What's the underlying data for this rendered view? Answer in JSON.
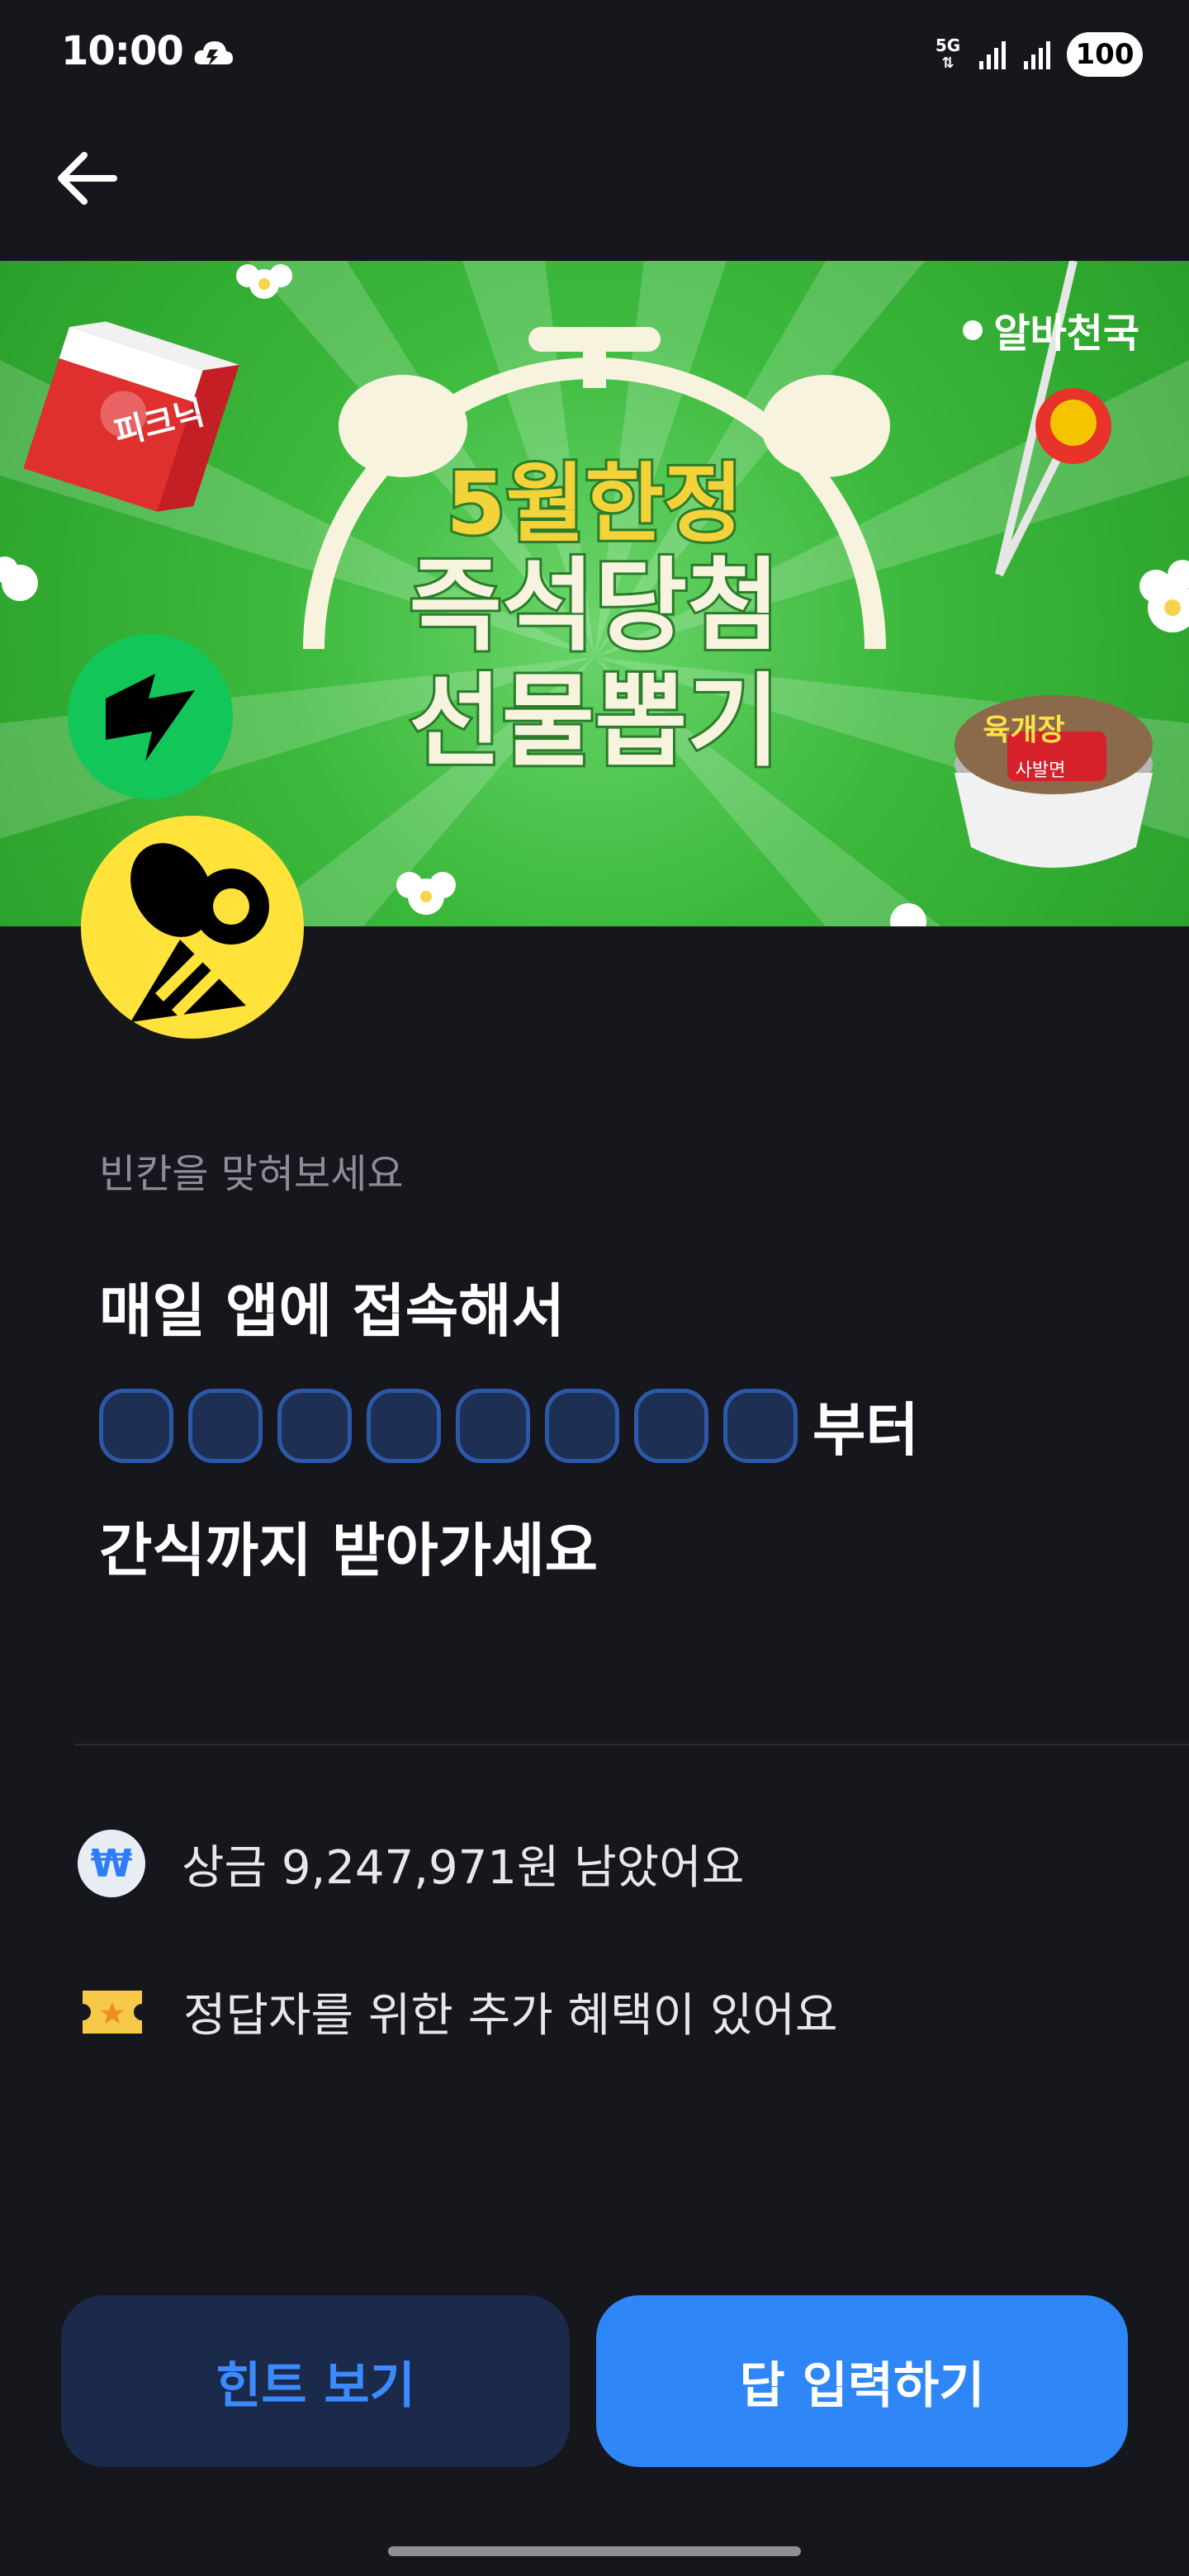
{
  "status_bar": {
    "time": "10:00",
    "network": "5G",
    "battery": "100"
  },
  "icons": {
    "back": "back-arrow-icon",
    "cloud": "cloud-icon",
    "won": "won-coin-icon",
    "ticket": "ticket-icon",
    "bee": "bee-icon"
  },
  "banner": {
    "brand": "알바천국",
    "title_line1": "5월한정",
    "title_line2": "즉석당첨",
    "title_line3": "선물뽑기",
    "juice_label": "피크닉",
    "noodle_label": "육개장",
    "noodle_sub": "사발면"
  },
  "quiz": {
    "label": "빈칸을 맞혀보세요",
    "line1": "매일 앱에 접속해서",
    "blank_count": 8,
    "blank_suffix": "부터",
    "line3": "간식까지 받아가세요"
  },
  "info": {
    "prize_text": "상금 9,247,971원 남았어요",
    "bonus_text": "정답자를 위한 추가 혜택이 있어요",
    "won_symbol": "₩"
  },
  "buttons": {
    "hint": "힌트 보기",
    "answer": "답 입력하기"
  },
  "colors": {
    "background": "#16161d",
    "banner_green": "#3cb93c",
    "accent_blue": "#2f86f6",
    "blank_border": "#2c58a7",
    "bee_yellow": "#ffe23a"
  }
}
